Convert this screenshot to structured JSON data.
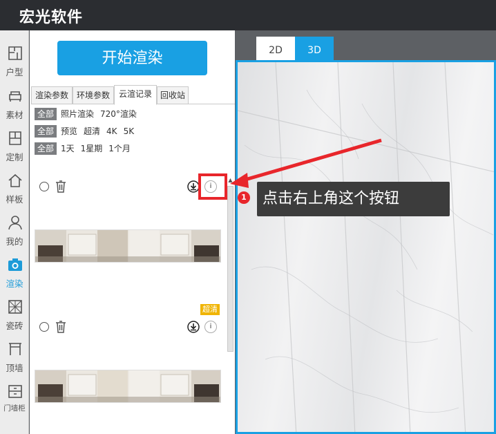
{
  "app": {
    "title": "宏光软件"
  },
  "leftnav": {
    "items": [
      {
        "label": "户型",
        "icon": "floorplan-icon"
      },
      {
        "label": "素材",
        "icon": "sofa-icon"
      },
      {
        "label": "定制",
        "icon": "cabinet-icon"
      },
      {
        "label": "样板",
        "icon": "house-icon"
      },
      {
        "label": "我的",
        "icon": "user-icon"
      },
      {
        "label": "渲染",
        "icon": "camera-icon",
        "active": true
      },
      {
        "label": "瓷砖",
        "icon": "tile-icon"
      },
      {
        "label": "顶墙",
        "icon": "ceiling-icon"
      },
      {
        "label": "门墙柜",
        "icon": "door-cabinet-icon"
      }
    ]
  },
  "panel": {
    "render_button": "开始渲染",
    "tabs": [
      "渲染参数",
      "环境参数",
      "云渲记录",
      "回收站"
    ],
    "active_tab": "云渲记录",
    "filters": [
      {
        "chip": "全部",
        "options": [
          "照片渲染",
          "720°渲染"
        ]
      },
      {
        "chip": "全部",
        "options": [
          "预览",
          "超清",
          "4K",
          "5K"
        ]
      },
      {
        "chip": "全部",
        "options": [
          "1天",
          "1星期",
          "1个月"
        ]
      }
    ],
    "records": [
      {
        "badge": "",
        "info": "i"
      },
      {
        "badge": "超清",
        "info": "i"
      }
    ]
  },
  "viewport": {
    "tabs": [
      "2D",
      "3D"
    ],
    "active_tab": "3D"
  },
  "annotation": {
    "step": "1",
    "text": "点击右上角这个按钮"
  },
  "colors": {
    "accent": "#19a0e3",
    "topbar": "#2b2d31",
    "annotation_red": "#e8262b",
    "badge": "#f0b400"
  }
}
